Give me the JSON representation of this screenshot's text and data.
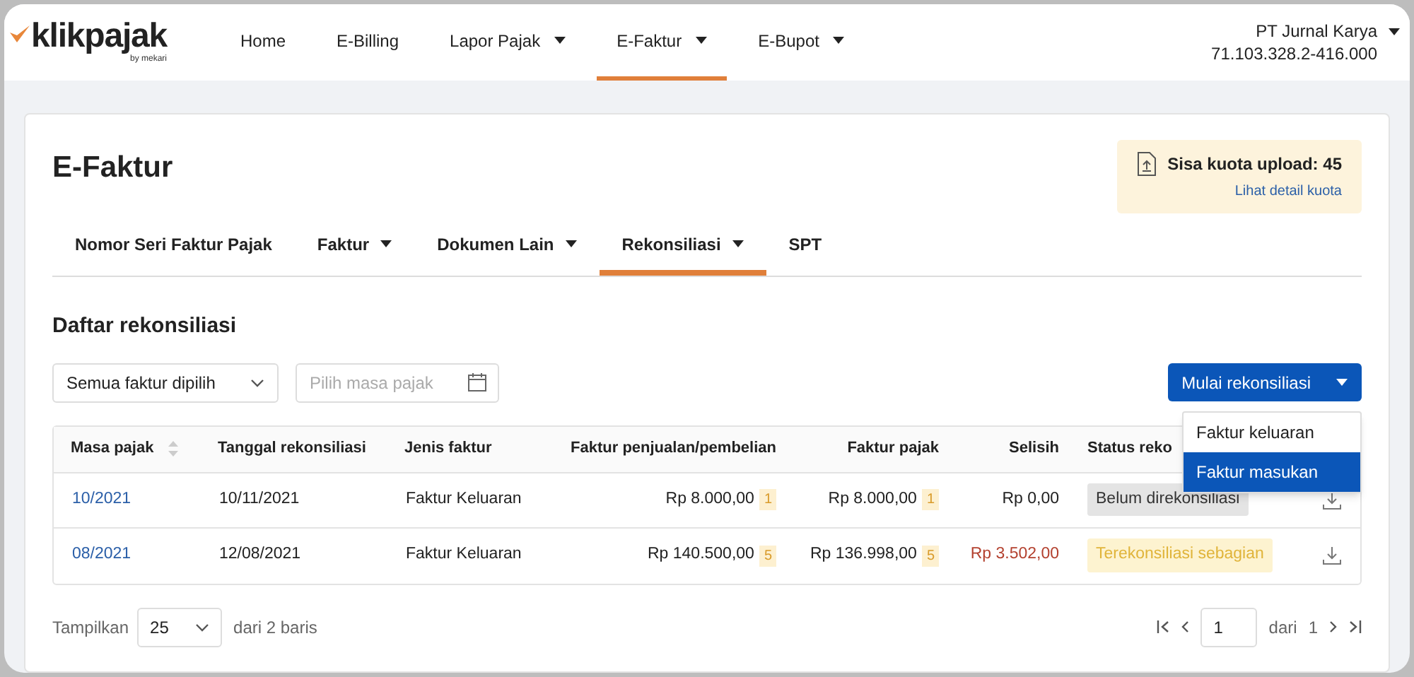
{
  "logo": {
    "name": "klikpajak",
    "tagline": "by mekari"
  },
  "nav": [
    {
      "label": "Home",
      "dropdown": false,
      "selected": false
    },
    {
      "label": "E-Billing",
      "dropdown": false,
      "selected": false
    },
    {
      "label": "Lapor Pajak",
      "dropdown": true,
      "selected": false
    },
    {
      "label": "E-Faktur",
      "dropdown": true,
      "selected": true
    },
    {
      "label": "E-Bupot",
      "dropdown": true,
      "selected": false
    }
  ],
  "account": {
    "name": "PT Jurnal Karya",
    "npwp": "71.103.328.2-416.000"
  },
  "page_title": "E-Faktur",
  "quota": {
    "label": "Sisa kuota upload: 45",
    "link": "Lihat detail kuota"
  },
  "tabs": [
    {
      "label": "Nomor Seri Faktur Pajak",
      "dropdown": false,
      "selected": false
    },
    {
      "label": "Faktur",
      "dropdown": true,
      "selected": false
    },
    {
      "label": "Dokumen Lain",
      "dropdown": true,
      "selected": false
    },
    {
      "label": "Rekonsiliasi",
      "dropdown": true,
      "selected": true
    },
    {
      "label": "SPT",
      "dropdown": false,
      "selected": false
    }
  ],
  "section_title": "Daftar rekonsiliasi",
  "filter_select": {
    "value": "Semua faktur dipilih"
  },
  "period_field": {
    "placeholder": "Pilih masa pajak"
  },
  "start_button": {
    "label": "Mulai rekonsiliasi",
    "menu": [
      {
        "label": "Faktur keluaran",
        "selected": false
      },
      {
        "label": "Faktur masukan",
        "selected": true
      }
    ]
  },
  "table": {
    "columns": [
      "Masa pajak",
      "Tanggal rekonsiliasi",
      "Jenis faktur",
      "Faktur penjualan/pembelian",
      "Faktur pajak",
      "Selisih",
      "Status reko"
    ],
    "rows": [
      {
        "period": "10/2021",
        "date": "10/11/2021",
        "type": "Faktur Keluaran",
        "sales": "Rp 8.000,00",
        "sales_count": "1",
        "tax": "Rp 8.000,00",
        "tax_count": "1",
        "difference": "Rp 0,00",
        "difference_negative": false,
        "status": "Belum direkonsiliasi",
        "kind": "pending"
      },
      {
        "period": "08/2021",
        "date": "12/08/2021",
        "type": "Faktur Keluaran",
        "sales": "Rp 140.500,00",
        "sales_count": "5",
        "tax": "Rp 136.998,00",
        "tax_count": "5",
        "difference": "Rp 3.502,00",
        "difference_negative": true,
        "status": "Terekonsiliasi sebagian",
        "kind": "partial"
      }
    ]
  },
  "pagination": {
    "show_label": "Tampilkan",
    "page_size": "25",
    "rows_info": "dari 2 baris",
    "page": "1",
    "of_label": "dari",
    "total_pages": "1"
  }
}
